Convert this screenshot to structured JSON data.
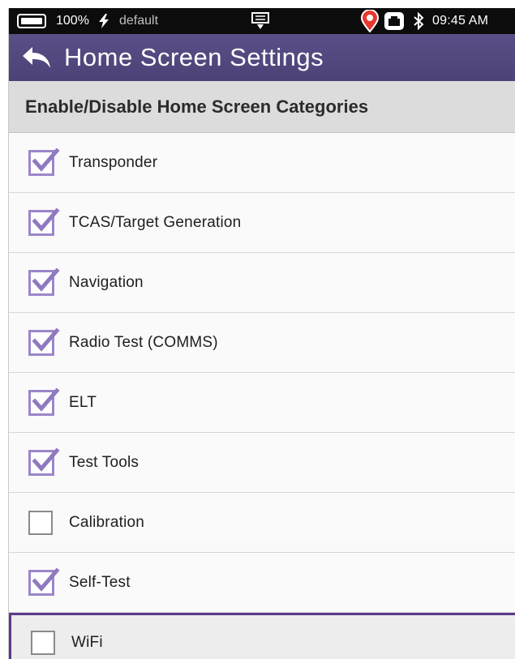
{
  "status_bar": {
    "battery_icon": "battery-full-icon",
    "battery_percent": "100%",
    "charging_icon": "lightning-bolt-icon",
    "profile": "default",
    "display_icon": "display-icon",
    "location_icon": "location-pin-icon",
    "lan_icon": "ethernet-icon",
    "bluetooth_icon": "bluetooth-icon",
    "time": "09:45 AM"
  },
  "title_bar": {
    "back_icon": "back-arrow-icon",
    "title": "Home Screen Settings",
    "color": "#504580"
  },
  "section": {
    "header": "Enable/Disable Home Screen Categories"
  },
  "categories": [
    {
      "label": "Transponder",
      "checked": true
    },
    {
      "label": "TCAS/Target Generation",
      "checked": true
    },
    {
      "label": "Navigation",
      "checked": true
    },
    {
      "label": "Radio Test (COMMS)",
      "checked": true
    },
    {
      "label": "ELT",
      "checked": true
    },
    {
      "label": "Test Tools",
      "checked": true
    },
    {
      "label": "Calibration",
      "checked": false
    },
    {
      "label": "Self-Test",
      "checked": true
    },
    {
      "label": "WiFi",
      "checked": false,
      "selected": true
    }
  ],
  "colors": {
    "checkbox_accent": "#9c86c9",
    "selection_border": "#5b3a8c"
  }
}
